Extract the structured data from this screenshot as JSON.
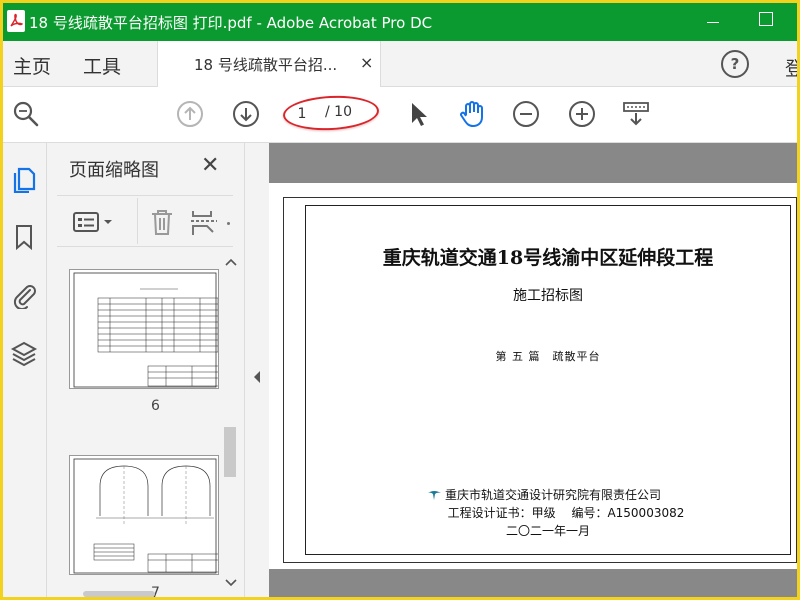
{
  "window": {
    "title": "18 号线疏散平台招标图 打印.pdf - Adobe Acrobat Pro DC"
  },
  "menu": {
    "home_label": "主页",
    "tools_label": "工具",
    "tab_label": "18 号线疏散平台招...",
    "tab_close": "×",
    "help_label": "?",
    "login_label": "登"
  },
  "toolbar": {
    "current_page": "1",
    "total_pages": "/ 10"
  },
  "thumbnail_panel": {
    "title": "页面缩略图",
    "close_label": "✕",
    "thumbnails": [
      {
        "page_label": "6"
      },
      {
        "page_label": "7"
      }
    ]
  },
  "document": {
    "title": "重庆轨道交通18号线渝中区延伸段工程",
    "subtitle": "施工招标图",
    "section": "第 五 篇　疏散平台",
    "company": "重庆市轨道交通设计研究院有限责任公司",
    "certificate": "工程设计证书：甲级　 编号：A150003082",
    "date": "二〇二一年一月"
  },
  "colors": {
    "titlebar": "#0b9a2f",
    "frame_highlight": "#f2d21c",
    "annotation": "#d9262c",
    "icon_blue": "#1473e6"
  }
}
